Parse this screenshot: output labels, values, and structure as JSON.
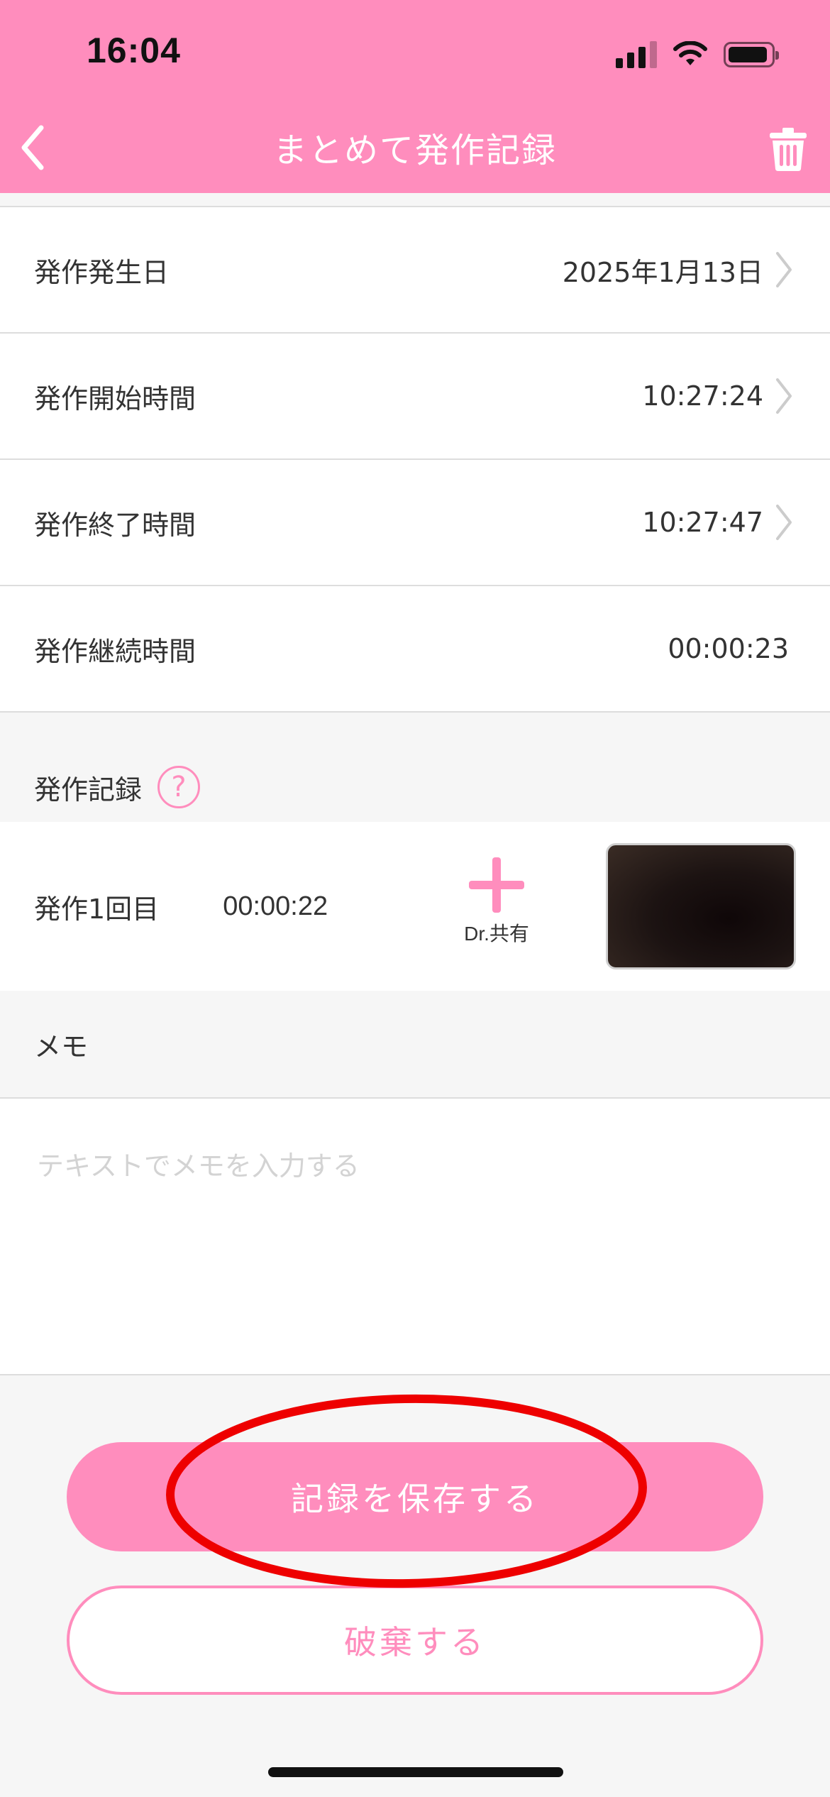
{
  "status_bar": {
    "time": "16:04"
  },
  "nav": {
    "title": "まとめて発作記録",
    "back_icon": "chevron-left-icon",
    "trash_icon": "trash-icon"
  },
  "rows": [
    {
      "label": "発作発生日",
      "value": "2025年1月13日",
      "has_chevron": true
    },
    {
      "label": "発作開始時間",
      "value": "10:27:24",
      "has_chevron": true
    },
    {
      "label": "発作終了時間",
      "value": "10:27:47",
      "has_chevron": true
    },
    {
      "label": "発作継続時間",
      "value": "00:00:23",
      "has_chevron": false
    }
  ],
  "seizure_records": {
    "title": "発作記録",
    "help_symbol": "?",
    "items": [
      {
        "count_label": "発作1回目",
        "duration": "00:00:22",
        "share_label": "Dr.共有"
      }
    ]
  },
  "memo": {
    "title": "メモ",
    "placeholder": "テキストでメモを入力する",
    "value": ""
  },
  "buttons": {
    "save_label": "記録を保存する",
    "discard_label": "破棄する"
  },
  "colors": {
    "accent": "#ff8dbd",
    "annotation": "#ee0000"
  }
}
